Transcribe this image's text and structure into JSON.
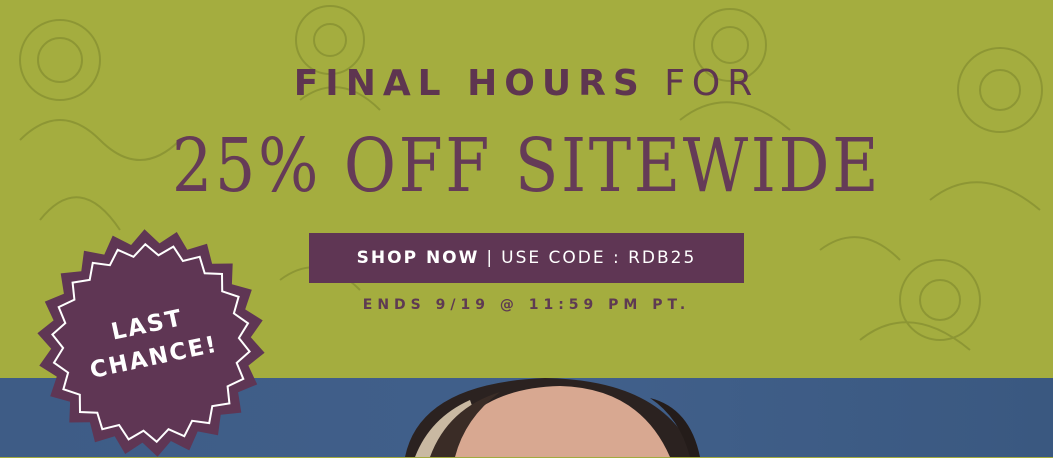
{
  "banner": {
    "headline_bold": "FINAL HOURS",
    "headline_light": "FOR",
    "headline_main": "25% OFF SITEWIDE",
    "cta_shop": "SHOP NOW",
    "cta_separator": "|",
    "cta_code": "USE CODE : RDB25",
    "ends": "ENDS 9/19 @ 11:59 PM PT."
  },
  "badge": {
    "line1": "LAST",
    "line2": "CHANCE!"
  },
  "colors": {
    "banner_bg": "#a4ad3f",
    "accent_plum": "#5f3654",
    "photo_bg": "#3e5c86"
  },
  "icons": {
    "badge_shape": "starburst-badge-icon",
    "decor": "floral-pattern-icon"
  }
}
